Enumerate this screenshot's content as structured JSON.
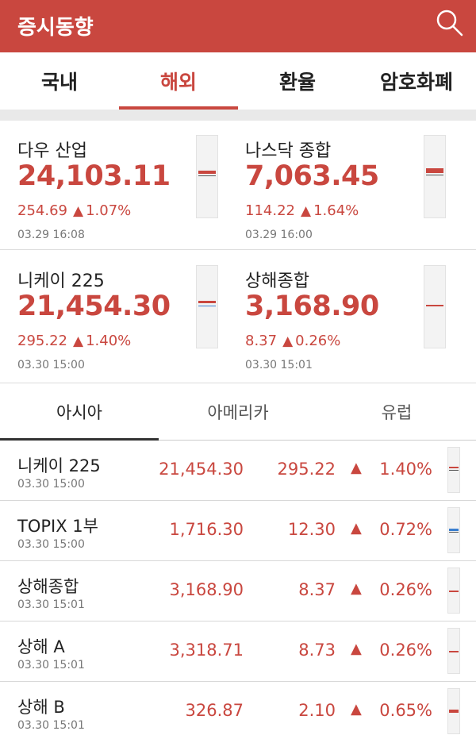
{
  "header": {
    "title": "증시동향",
    "icon": "search-icon"
  },
  "tabs": [
    {
      "label": "국내",
      "active": false
    },
    {
      "label": "해외",
      "active": true
    },
    {
      "label": "환율",
      "active": false
    },
    {
      "label": "암호화폐",
      "active": false
    }
  ],
  "cards": [
    {
      "name": "다우 산업",
      "price": "24,103.11",
      "change": "254.69",
      "percent": "1.07%",
      "time": "03.29 16:08"
    },
    {
      "name": "나스닥 종합",
      "price": "7,063.45",
      "change": "114.22",
      "percent": "1.64%",
      "time": "03.29 16:00"
    },
    {
      "name": "니케이 225",
      "price": "21,454.30",
      "change": "295.22",
      "percent": "1.40%",
      "time": "03.30 15:00"
    },
    {
      "name": "상해종합",
      "price": "3,168.90",
      "change": "8.37",
      "percent": "0.26%",
      "time": "03.30 15:01"
    }
  ],
  "subtabs": [
    {
      "label": "아시아",
      "active": true
    },
    {
      "label": "아메리카",
      "active": false
    },
    {
      "label": "유럽",
      "active": false
    }
  ],
  "rows": [
    {
      "name": "니케이 225",
      "time": "03.30 15:00",
      "price": "21,454.30",
      "change": "295.22",
      "percent": "1.40%"
    },
    {
      "name": "TOPIX 1부",
      "time": "03.30 15:00",
      "price": "1,716.30",
      "change": "12.30",
      "percent": "0.72%"
    },
    {
      "name": "상해종합",
      "time": "03.30 15:01",
      "price": "3,168.90",
      "change": "8.37",
      "percent": "0.26%"
    },
    {
      "name": "상해 A",
      "time": "03.30 15:01",
      "price": "3,318.71",
      "change": "8.73",
      "percent": "0.26%"
    },
    {
      "name": "상해 B",
      "time": "03.30 15:01",
      "price": "326.87",
      "change": "2.10",
      "percent": "0.65%"
    }
  ],
  "symbols": {
    "up_arrow": "▲"
  },
  "colors": {
    "accent": "#c9473f",
    "up": "#c9473f",
    "sparkline_blue": "#3a7fd0"
  }
}
